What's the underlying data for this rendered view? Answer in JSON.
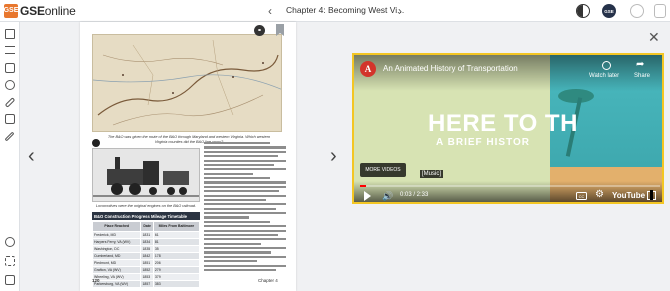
{
  "header": {
    "logo_mark": "GSE",
    "logo_brand": "GSE",
    "logo_suffix": "online",
    "chapter_title": "Chapter 4: Becoming West Vi...",
    "user_initials": "GSE"
  },
  "page": {
    "map_caption": "The B&O was given the route of the B&O through Maryland and western Virginia. Which western Virginia counties did the B&O line cross?",
    "train_caption": "Locomotives were the original engines on the B&O railroad.",
    "table_title": "B&O Construction Progress Mileage Timetable",
    "table_headers": [
      "Place Reached",
      "Date",
      "Miles From Baltimore"
    ],
    "table_rows": [
      [
        "Frederick, MD",
        "1831",
        "61"
      ],
      [
        "Harpers Ferry, VA (WV)",
        "1834",
        "81"
      ],
      [
        "Washington, DC",
        "1835",
        "35"
      ],
      [
        "Cumberland, MD",
        "1842",
        "178"
      ],
      [
        "Piedmont, MD",
        "1851",
        "206"
      ],
      [
        "Grafton, VA (WV)",
        "1852",
        "279"
      ],
      [
        "Wheeling, VA (WV)",
        "1853",
        "379"
      ],
      [
        "Parkersburg, VA (WV)",
        "1857",
        "383"
      ]
    ],
    "page_number": "120",
    "chapter_footer": "Chapter 4"
  },
  "video": {
    "channel_letter": "A",
    "title": "An Animated History of Transportation",
    "watch_later": "Watch later",
    "share": "Share",
    "headline": "HERE TO TH",
    "subheadline": "A BRIEF HISTOR",
    "more_videos": "MORE VIDEOS",
    "caption": "[Music]",
    "time": "0:03 / 2:33",
    "brand": "YouTube",
    "progress": 0.02
  },
  "colors": {
    "accent_orange": "#e8772e",
    "video_border": "#f3c623",
    "progress_red": "#ff0000"
  }
}
